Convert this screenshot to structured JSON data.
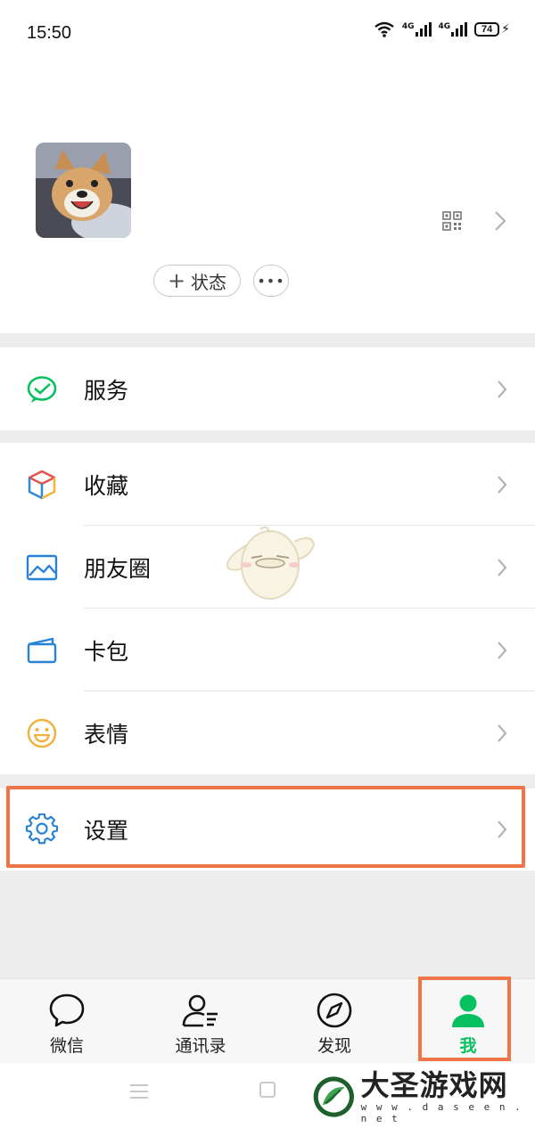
{
  "status_bar": {
    "time": "15:50",
    "signal1_label": "4G",
    "signal2_label": "4G",
    "battery_level": "74"
  },
  "profile": {
    "status_button_label": "状态",
    "more_button_label": "•••",
    "avatar_icon": "dog-photo",
    "qr_icon": "qr-code-icon"
  },
  "menu": {
    "service": {
      "label": "服务",
      "icon": "wechat-pay-icon",
      "color": "#07c160"
    },
    "favorites": {
      "label": "收藏",
      "icon": "cube-icon"
    },
    "moments": {
      "label": "朋友圈",
      "icon": "image-icon",
      "color": "#2782d7"
    },
    "cards": {
      "label": "卡包",
      "icon": "wallet-icon",
      "color": "#2782d7"
    },
    "stickers": {
      "label": "表情",
      "icon": "smiley-icon",
      "color": "#f0b240"
    },
    "settings": {
      "label": "设置",
      "icon": "gear-icon",
      "color": "#2782d7"
    }
  },
  "tabbar": {
    "chats": {
      "label": "微信",
      "icon": "chat-bubble-icon"
    },
    "contacts": {
      "label": "通讯录",
      "icon": "contacts-icon"
    },
    "discover": {
      "label": "发现",
      "icon": "compass-icon"
    },
    "me": {
      "label": "我",
      "icon": "person-icon",
      "active": true,
      "color": "#07c160"
    }
  },
  "watermark": {
    "title": "大圣游戏网",
    "url": "w w w . d a s e e n . n e t"
  },
  "colors": {
    "highlight": "#ef7549",
    "accent": "#07c160",
    "background": "#ededed"
  }
}
